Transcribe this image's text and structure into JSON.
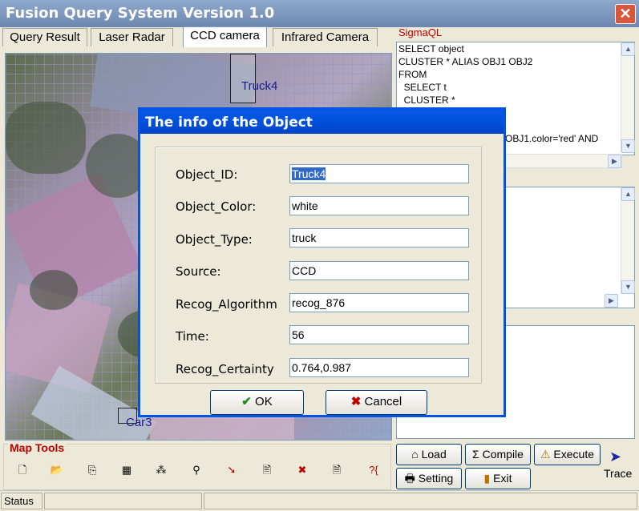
{
  "window": {
    "title": "Fusion Query System Version 1.0",
    "close_glyph": "✕"
  },
  "tabs": [
    {
      "label": "Query Result"
    },
    {
      "label": "Laser Radar"
    },
    {
      "label": "CCD camera",
      "active": true
    },
    {
      "label": "Infrared Camera"
    }
  ],
  "map": {
    "labels": {
      "truck": "Truck4",
      "car": "Car3"
    }
  },
  "sigmaql": {
    "label": "SigmaQL",
    "lines": [
      "SELECT object",
      "CLUSTER * ALIAS OBJ1 OBJ2",
      "FROM",
      "  SELECT t",
      "  CLUSTER *",
      "OBJ1.color='red' AND"
    ]
  },
  "map_tools": {
    "label": "Map Tools",
    "tools": [
      {
        "icon": "new-file-icon",
        "glyph": "🗋"
      },
      {
        "icon": "open-folder-icon",
        "glyph": "📂"
      },
      {
        "icon": "import-icon",
        "glyph": "⎘"
      },
      {
        "icon": "table-icon",
        "glyph": "▦"
      },
      {
        "icon": "grid-select-icon",
        "glyph": "⁂"
      },
      {
        "icon": "tree-icon",
        "glyph": "⚲"
      },
      {
        "icon": "pointer-icon",
        "glyph": "➘"
      },
      {
        "icon": "document-edit-icon",
        "glyph": "🖹"
      },
      {
        "icon": "delete-icon",
        "glyph": "✖"
      },
      {
        "icon": "page-icon",
        "glyph": "🗎"
      },
      {
        "icon": "query-icon",
        "glyph": "?{"
      }
    ]
  },
  "buttons": {
    "load": "Load",
    "compile": "Compile",
    "execute": "Execute",
    "setting": "Setting",
    "exit": "Exit",
    "trace": "Trace"
  },
  "status": {
    "label": "Status"
  },
  "dialog": {
    "title": "The info of the Object",
    "fields": [
      {
        "label": "Object_ID:",
        "value": "Truck4"
      },
      {
        "label": "Object_Color:",
        "value": "white"
      },
      {
        "label": "Object_Type:",
        "value": "truck"
      },
      {
        "label": "Source:",
        "value": "CCD"
      },
      {
        "label": "Recog_Algorithm",
        "value": "recog_876"
      },
      {
        "label": "Time:",
        "value": "56"
      },
      {
        "label": "Recog_Certainty",
        "value": "0.764,0.987"
      }
    ],
    "ok": "OK",
    "cancel": "Cancel"
  },
  "colors": {
    "title_bar": "#6d87b0",
    "dialog_title": "#0054e3",
    "group_label": "#c00000",
    "map_label": "#1a1a8c"
  }
}
